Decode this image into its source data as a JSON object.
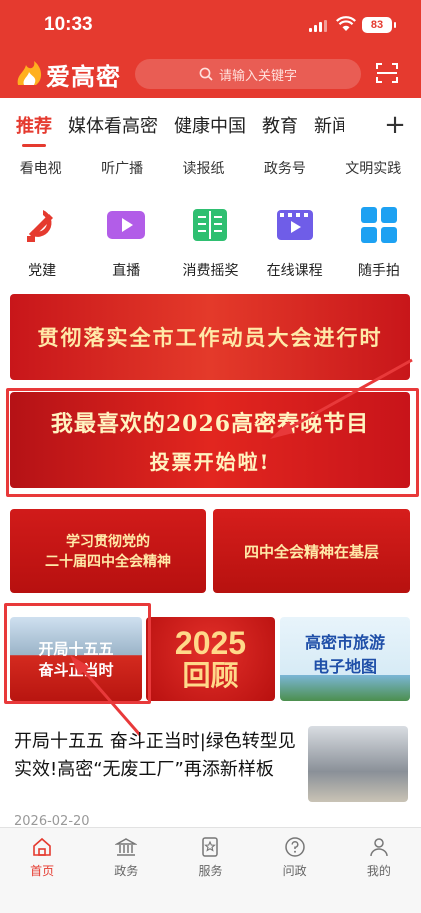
{
  "status": {
    "time": "10:33",
    "battery": "83"
  },
  "header": {
    "logo_text": "爱高密",
    "search_placeholder": "请输入关键字"
  },
  "tabs": [
    "推荐",
    "媒体看高密",
    "健康中国",
    "教育",
    "新闻"
  ],
  "subnav": [
    "看电视",
    "听广播",
    "读报纸",
    "政务号",
    "文明实践"
  ],
  "quick_icons": [
    {
      "label": "党建",
      "icon": "party-icon"
    },
    {
      "label": "直播",
      "icon": "live-icon"
    },
    {
      "label": "消费摇奖",
      "icon": "lottery-icon"
    },
    {
      "label": "在线课程",
      "icon": "course-icon"
    },
    {
      "label": "随手拍",
      "icon": "snap-icon"
    }
  ],
  "banners": {
    "b1": "贯彻落实全市工作动员大会进行时",
    "b2_line1": "我最喜欢的2026高密春晚节目",
    "b2_line2": "投票开始啦!",
    "b3_line1": "学习贯彻党的",
    "b3_line2": "二十届四中全会精神",
    "b4": "四中全会精神在基层",
    "b5_line1": "开局十五五",
    "b5_line2": "奋斗正当时",
    "b6_year": "2025",
    "b6_text": "回顾",
    "b7_line1": "高密市旅游",
    "b7_line2": "电子地图"
  },
  "news": {
    "title": "开局十五五 奋斗正当时|绿色转型见实效!高密“无废工厂”再添新样板",
    "date": "2026-02-20"
  },
  "bottom_nav": [
    {
      "label": "首页",
      "icon": "home-icon"
    },
    {
      "label": "政务",
      "icon": "government-icon"
    },
    {
      "label": "服务",
      "icon": "service-icon"
    },
    {
      "label": "问政",
      "icon": "question-icon"
    },
    {
      "label": "我的",
      "icon": "profile-icon"
    }
  ],
  "colors": {
    "brand": "#e53a2f",
    "annotation": "#e8393a"
  }
}
